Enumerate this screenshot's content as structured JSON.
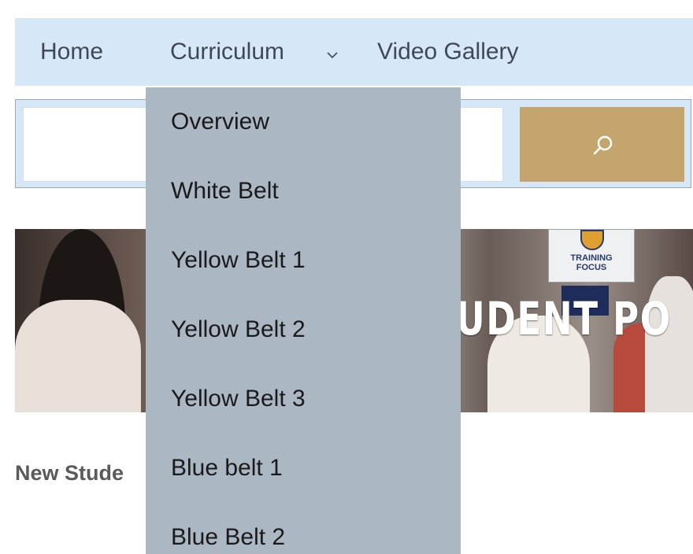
{
  "nav": {
    "items": [
      {
        "label": "Home"
      },
      {
        "label": "Curriculum"
      },
      {
        "label": "Video Gallery"
      }
    ]
  },
  "search": {
    "value": "",
    "placeholder": ""
  },
  "hero": {
    "banner_text": "UDENT PO",
    "sign_text_1": "TRAINING",
    "sign_text_2": "FOCUS"
  },
  "content": {
    "heading": "New Stude"
  },
  "dropdown": {
    "items": [
      {
        "label": "Overview"
      },
      {
        "label": "White Belt"
      },
      {
        "label": "Yellow Belt 1"
      },
      {
        "label": "Yellow Belt 2"
      },
      {
        "label": "Yellow Belt 3"
      },
      {
        "label": "Blue belt 1"
      },
      {
        "label": "Blue Belt 2"
      }
    ]
  },
  "colors": {
    "nav_background": "#d6e8f8",
    "dropdown_background": "#abb8c4",
    "search_button": "#c4a56e"
  },
  "icons": {
    "dropdown": "chevron-down-icon",
    "search": "search-icon"
  }
}
